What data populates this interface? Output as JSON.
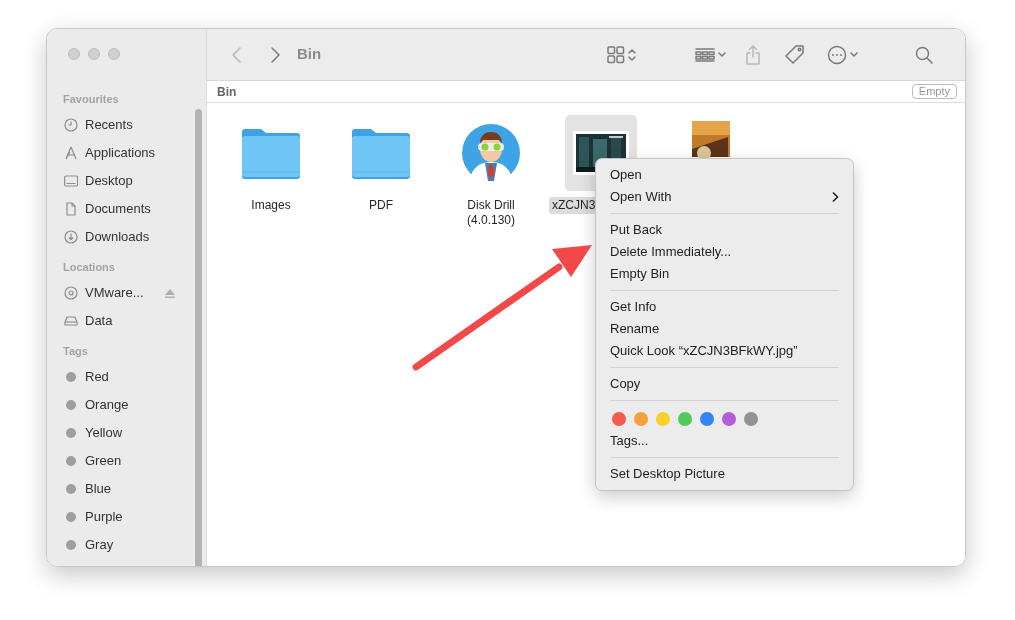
{
  "window": {
    "title": "Bin"
  },
  "toolbar": [
    {
      "kind": "back",
      "disabled": true
    },
    {
      "kind": "forward",
      "disabled": false
    },
    {
      "kind": "view",
      "disabled": false
    },
    {
      "kind": "group",
      "disabled": false
    },
    {
      "kind": "share",
      "disabled": true
    },
    {
      "kind": "tag",
      "disabled": false
    },
    {
      "kind": "more",
      "disabled": false
    },
    {
      "kind": "search",
      "disabled": false
    }
  ],
  "sidebar": {
    "sections": [
      {
        "heading": "Favourites",
        "items": [
          {
            "label": "Recents",
            "kind": "clock"
          },
          {
            "label": "Applications",
            "kind": "apps"
          },
          {
            "label": "Desktop",
            "kind": "desktop"
          },
          {
            "label": "Documents",
            "kind": "doc"
          },
          {
            "label": "Downloads",
            "kind": "download"
          }
        ]
      },
      {
        "heading": "Locations",
        "items": [
          {
            "label": "VMware...",
            "kind": "disc",
            "ejectable": true
          },
          {
            "label": "Data",
            "kind": "drive"
          }
        ]
      },
      {
        "heading": "Tags",
        "items": [
          {
            "label": "Red",
            "kind": "tag"
          },
          {
            "label": "Orange",
            "kind": "tag"
          },
          {
            "label": "Yellow",
            "kind": "tag"
          },
          {
            "label": "Green",
            "kind": "tag"
          },
          {
            "label": "Blue",
            "kind": "tag"
          },
          {
            "label": "Purple",
            "kind": "tag"
          },
          {
            "label": "Gray",
            "kind": "tag"
          }
        ]
      }
    ]
  },
  "path_bar": {
    "title": "Bin",
    "button": "Empty"
  },
  "files": [
    {
      "name": "Images",
      "kind": "folder",
      "selected": false
    },
    {
      "name": "PDF",
      "kind": "folder",
      "selected": false
    },
    {
      "name": "Disk Drill\n(4.0.130)",
      "kind": "app",
      "selected": false
    },
    {
      "name": "xZCJN3",
      "kind": "picture",
      "selected": true
    },
    {
      "kind": "picture",
      "selected": false
    }
  ],
  "context_menu": {
    "groups": [
      [
        {
          "label": "Open"
        },
        {
          "label": "Open With",
          "submenu": true
        }
      ],
      [
        {
          "label": "Put Back"
        },
        {
          "label": "Delete Immediately..."
        },
        {
          "label": "Empty Bin"
        }
      ],
      [
        {
          "label": "Get Info"
        },
        {
          "label": "Rename"
        },
        {
          "label": "Quick Look “xZCJN3BFkWY.jpg”"
        }
      ],
      [
        {
          "label": "Copy"
        }
      ],
      [
        {
          "kind": "colors",
          "colors": [
            {
              "color": "#f55a4e"
            },
            {
              "color": "#f5a03a"
            },
            {
              "color": "#f8d12d"
            },
            {
              "color": "#4fcb57"
            },
            {
              "color": "#3584f5"
            },
            {
              "color": "#b05fd6"
            },
            {
              "color": "#929295"
            }
          ]
        },
        {
          "label": "Tags..."
        }
      ],
      [
        {
          "label": "Set Desktop Picture"
        }
      ]
    ]
  },
  "annotation": {
    "kind": "arrow"
  }
}
